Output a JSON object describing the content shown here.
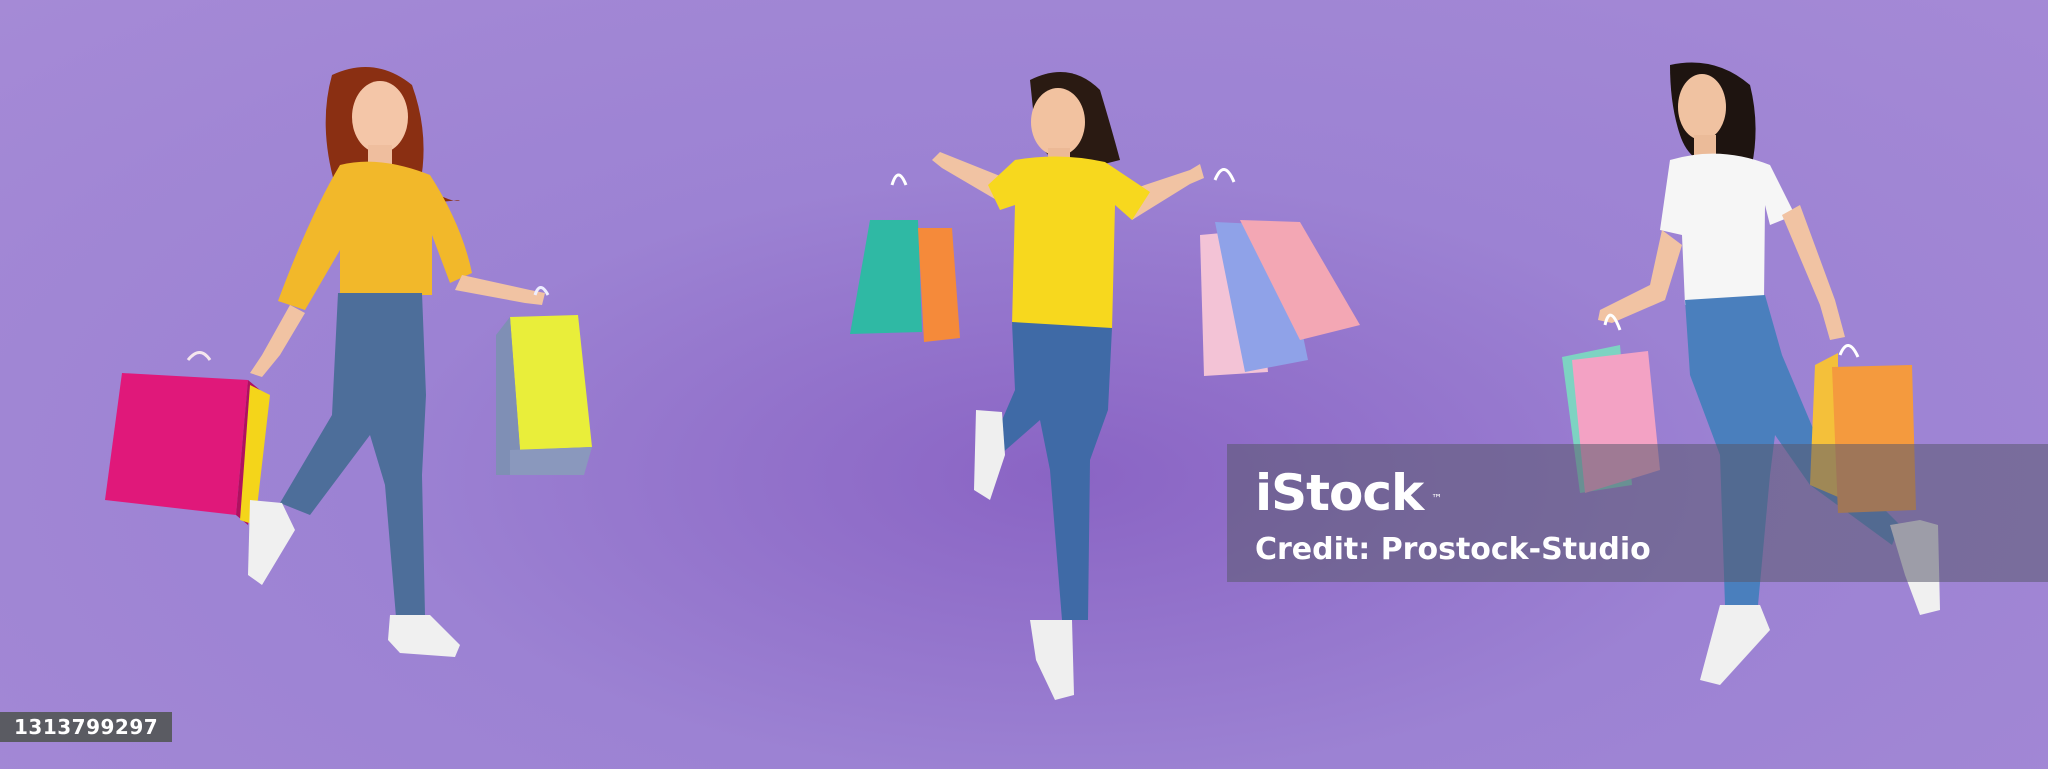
{
  "photo": {
    "subjects": [
      {
        "top_color": "#f2b82a",
        "pants_color": "#4d6e9a",
        "hair_color": "#8a2f12",
        "bag_colors": [
          "#e0187a",
          "#f4d51a",
          "#e9ee3a",
          "#7f8fb5"
        ]
      },
      {
        "top_color": "#f7d81e",
        "pants_color": "#3f6aa6",
        "hair_color": "#2a1a12",
        "bag_colors": [
          "#2fb9a4",
          "#f58a3a",
          "#f3a7b4",
          "#8fa2e8"
        ]
      },
      {
        "top_color": "#f6f6f6",
        "pants_color": "#4a7fbd",
        "hair_color": "#1e1410",
        "bag_colors": [
          "#f3a2c4",
          "#f49a3e",
          "#f4c03a"
        ]
      }
    ],
    "background_color": "#a08bd6"
  },
  "watermark": {
    "brand": "iStock",
    "trademark": "™",
    "credit": "Credit: Prostock-Studio"
  },
  "image_id": "1313799297"
}
